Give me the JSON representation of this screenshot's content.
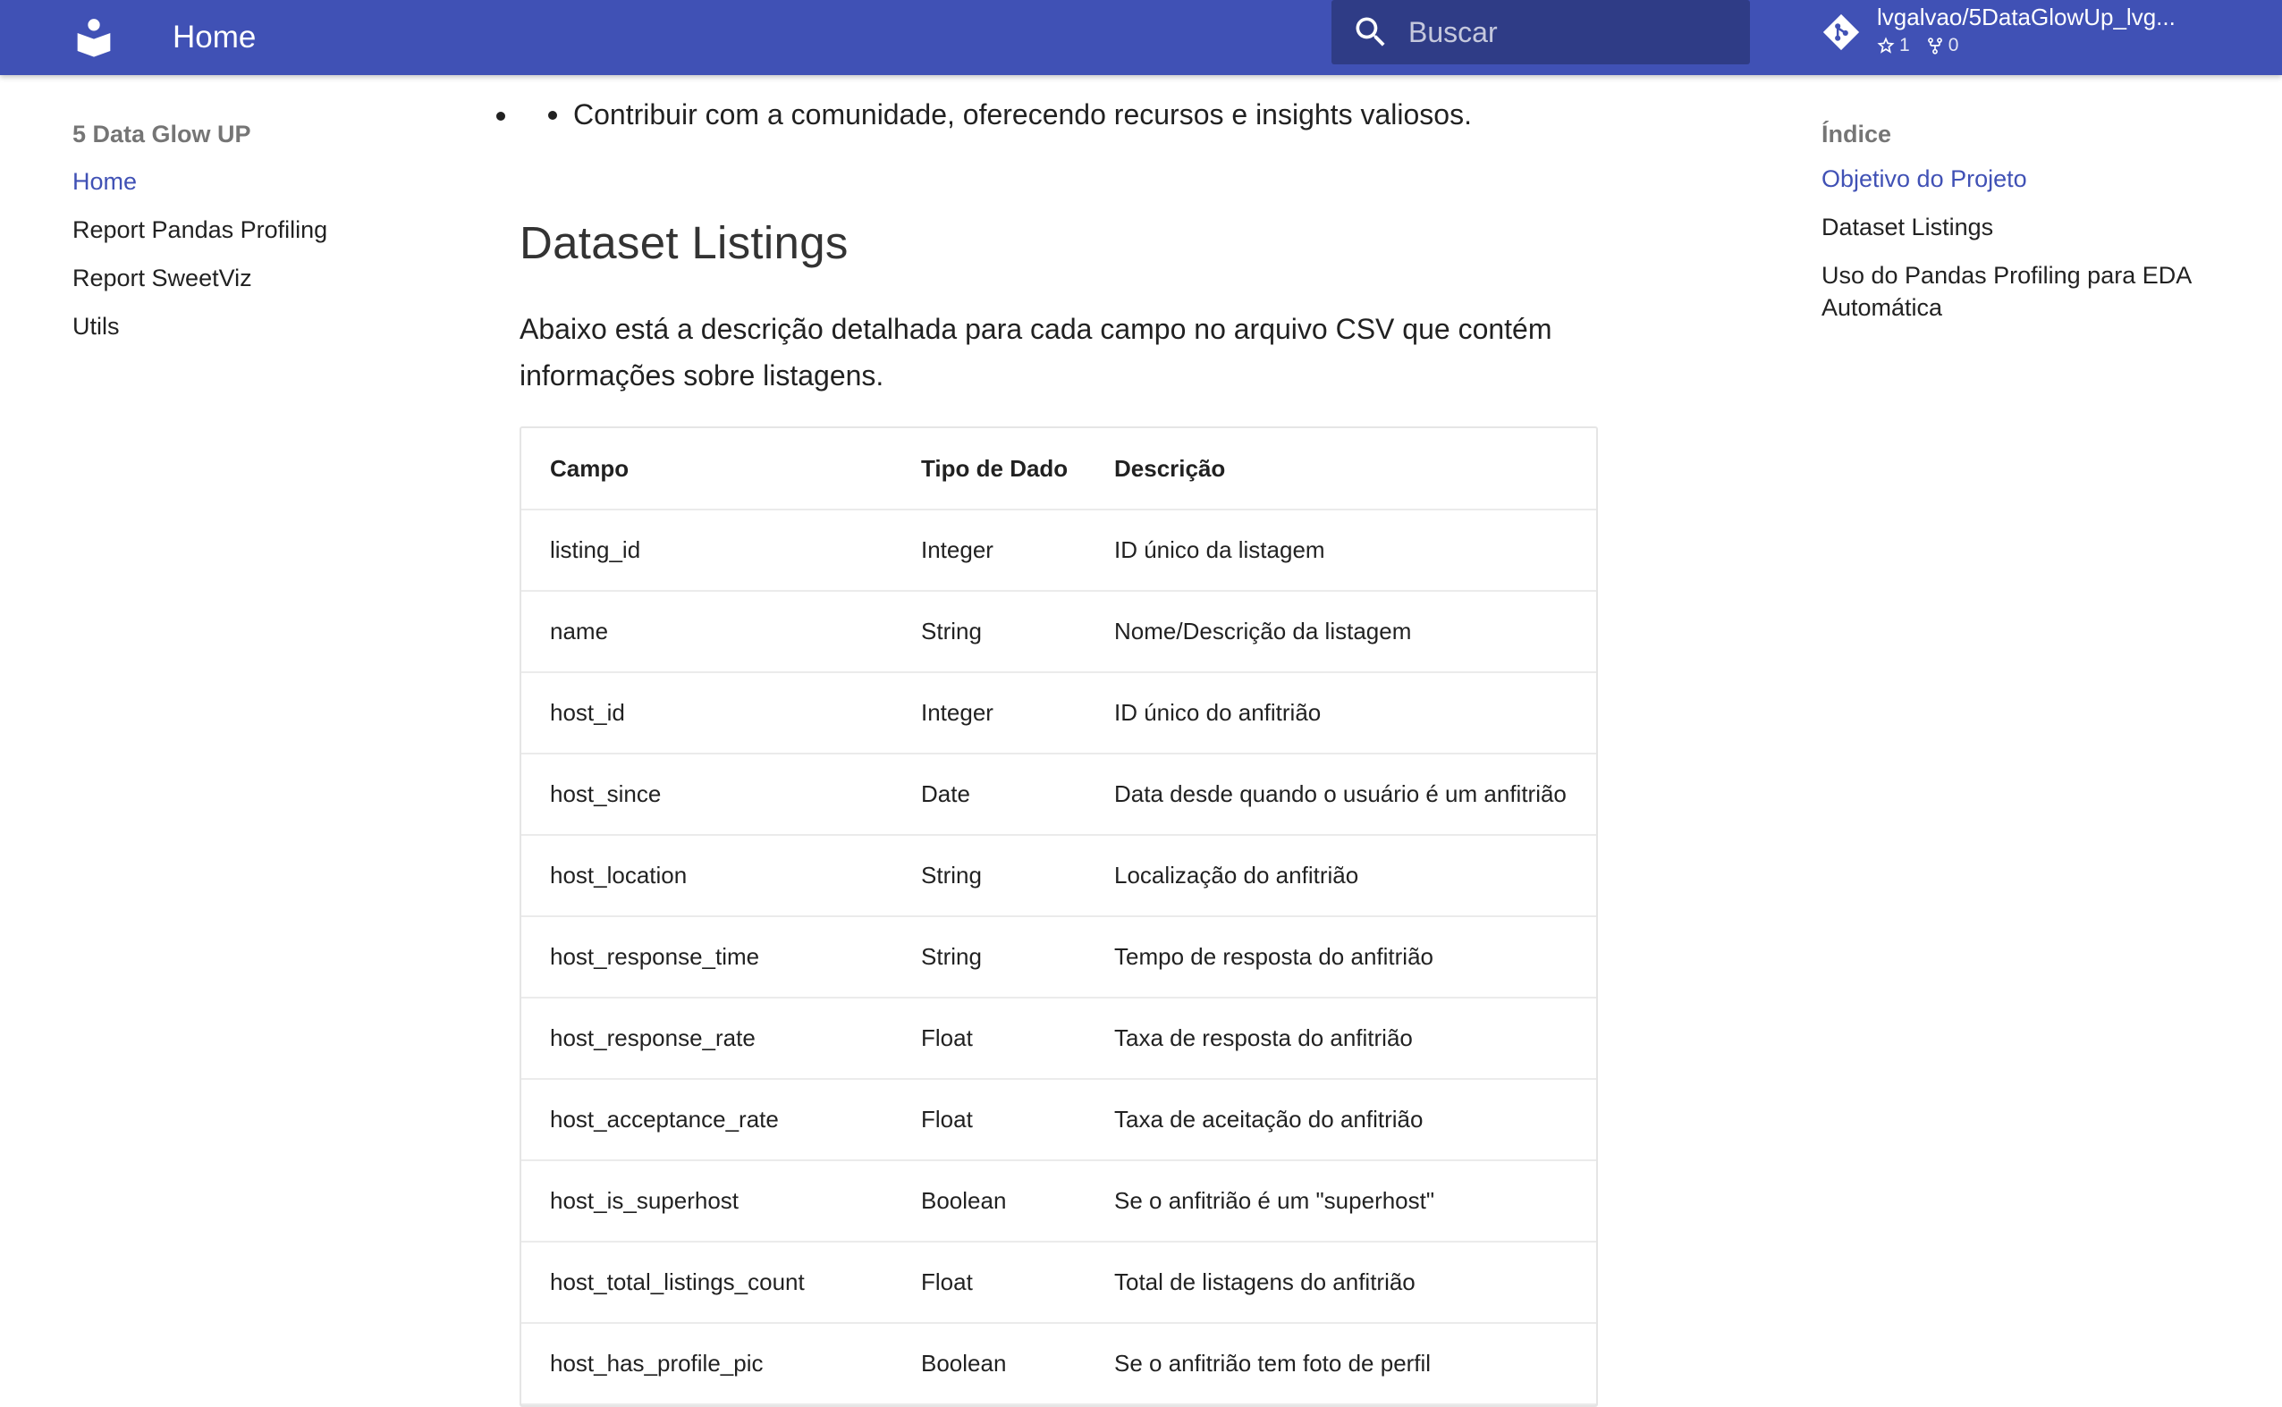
{
  "header": {
    "title": "Home",
    "search_placeholder": "Buscar",
    "repo": {
      "name": "lvgalvao/5DataGlowUp_lvg...",
      "stars": "1",
      "forks": "0"
    }
  },
  "nav": {
    "title": "5 Data Glow UP",
    "items": [
      {
        "label": "Home",
        "active": true
      },
      {
        "label": "Report Pandas Profiling",
        "active": false
      },
      {
        "label": "Report SweetViz",
        "active": false
      },
      {
        "label": "Utils",
        "active": false
      }
    ]
  },
  "toc": {
    "title": "Índice",
    "items": [
      {
        "label": "Objetivo do Projeto",
        "active": true
      },
      {
        "label": "Dataset Listings",
        "active": false
      },
      {
        "label": "Uso do Pandas Profiling para EDA Automática",
        "active": false
      }
    ]
  },
  "main": {
    "bullet": "Contribuir com a comunidade, oferecendo recursos e insights valiosos.",
    "section_title": "Dataset Listings",
    "intro": "Abaixo está a descrição detalhada para cada campo no arquivo CSV que contém informações sobre listagens.",
    "table": {
      "headers": [
        "Campo",
        "Tipo de Dado",
        "Descrição"
      ],
      "rows": [
        [
          "listing_id",
          "Integer",
          "ID único da listagem"
        ],
        [
          "name",
          "String",
          "Nome/Descrição da listagem"
        ],
        [
          "host_id",
          "Integer",
          "ID único do anfitrião"
        ],
        [
          "host_since",
          "Date",
          "Data desde quando o usuário é um anfitrião"
        ],
        [
          "host_location",
          "String",
          "Localização do anfitrião"
        ],
        [
          "host_response_time",
          "String",
          "Tempo de resposta do anfitrião"
        ],
        [
          "host_response_rate",
          "Float",
          "Taxa de resposta do anfitrião"
        ],
        [
          "host_acceptance_rate",
          "Float",
          "Taxa de aceitação do anfitrião"
        ],
        [
          "host_is_superhost",
          "Boolean",
          "Se o anfitrião é um \"superhost\""
        ],
        [
          "host_total_listings_count",
          "Float",
          "Total de listagens do anfitrião"
        ],
        [
          "host_has_profile_pic",
          "Boolean",
          "Se o anfitrião tem foto de perfil"
        ]
      ]
    }
  },
  "colors": {
    "primary": "#4051b5",
    "link_active": "#4051b5"
  },
  "icons": {
    "logo": "book-reader-icon",
    "search": "magnify-icon",
    "repo": "git-diamond-icon",
    "stars": "star-outline-icon",
    "forks": "fork-icon"
  }
}
